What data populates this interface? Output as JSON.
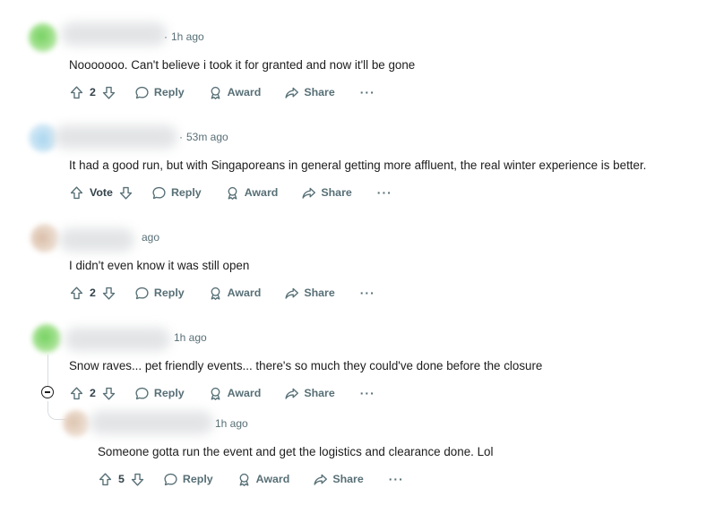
{
  "comments": [
    {
      "time": "1h ago",
      "text": "Nooooooo. Can't believe i took it for granted and now it'll be gone",
      "votes": "2",
      "reply": "Reply",
      "award": "Award",
      "share": "Share",
      "more": "···"
    },
    {
      "time": "53m ago",
      "text": "It had a good run, but with Singaporeans in general getting more affluent, the real winter experience is better.",
      "votes": "Vote",
      "reply": "Reply",
      "award": "Award",
      "share": "Share",
      "more": "···"
    },
    {
      "time": "ago",
      "text": "I didn't even know it was still open",
      "votes": "2",
      "reply": "Reply",
      "award": "Award",
      "share": "Share",
      "more": "···"
    },
    {
      "time": "1h ago",
      "text": "Snow raves... pet friendly events... there's so much they could've done before the closure",
      "votes": "2",
      "reply": "Reply",
      "award": "Award",
      "share": "Share",
      "more": "···"
    },
    {
      "time": "1h ago",
      "text": "Someone gotta run the event and get the logistics and clearance done. Lol",
      "votes": "5",
      "reply": "Reply",
      "award": "Award",
      "share": "Share",
      "more": "···"
    }
  ],
  "colors": {
    "meta": "#576f76",
    "text": "#1c1c1c",
    "avatar_green": "#7fd36a",
    "avatar_blue": "#bfe0f2",
    "avatar_beige": "#e8d6c6"
  },
  "icons": [
    "upvote-icon",
    "downvote-icon",
    "reply-icon",
    "award-icon",
    "share-icon",
    "more-icon",
    "collapse-icon"
  ]
}
